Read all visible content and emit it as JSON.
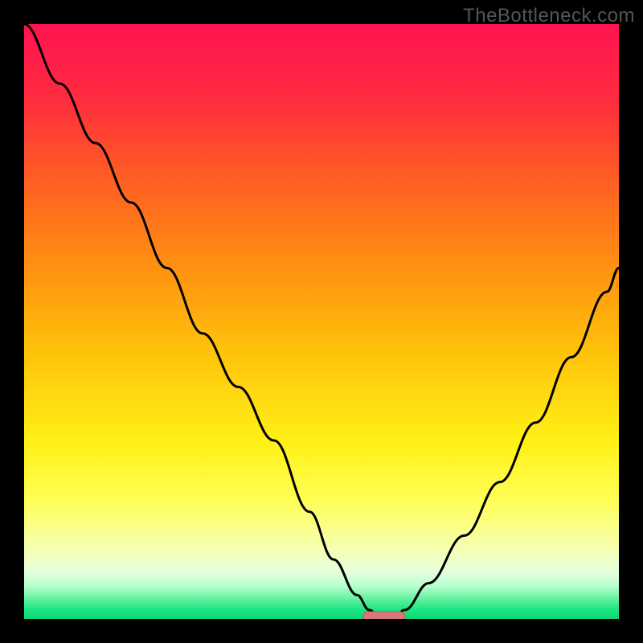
{
  "watermark": "TheBottleneck.com",
  "colors": {
    "frame": "#000000",
    "curve": "#000000",
    "watermark": "#555555",
    "gradient_stops": [
      {
        "offset": 0.0,
        "color": "#ff1351"
      },
      {
        "offset": 0.12,
        "color": "#ff2a40"
      },
      {
        "offset": 0.25,
        "color": "#ff5a25"
      },
      {
        "offset": 0.4,
        "color": "#ff8e12"
      },
      {
        "offset": 0.55,
        "color": "#ffc20a"
      },
      {
        "offset": 0.7,
        "color": "#fff015"
      },
      {
        "offset": 0.8,
        "color": "#ffff55"
      },
      {
        "offset": 0.88,
        "color": "#f6ffb0"
      },
      {
        "offset": 0.92,
        "color": "#e7ffdc"
      },
      {
        "offset": 0.945,
        "color": "#b6ffcf"
      },
      {
        "offset": 0.965,
        "color": "#68f2a1"
      },
      {
        "offset": 0.985,
        "color": "#18e680"
      },
      {
        "offset": 1.0,
        "color": "#0fd877"
      }
    ],
    "marker_fill": "#d9777a",
    "marker_stroke": "#bb5c5f"
  },
  "chart_data": {
    "type": "line",
    "title": "",
    "xlabel": "",
    "ylabel": "",
    "xlim": [
      0,
      100
    ],
    "ylim": [
      0,
      100
    ],
    "x": [
      0,
      6,
      12,
      18,
      24,
      30,
      36,
      42,
      48,
      52,
      56,
      58,
      60,
      62,
      64,
      68,
      74,
      80,
      86,
      92,
      98,
      100
    ],
    "values": [
      100,
      90,
      80,
      70,
      59,
      48,
      39,
      30,
      18,
      10,
      4,
      1.5,
      0,
      0,
      1.5,
      6,
      14,
      23,
      33,
      44,
      55,
      59
    ],
    "marker": {
      "x_range": [
        57,
        64
      ],
      "y": 0
    },
    "annotations": []
  }
}
